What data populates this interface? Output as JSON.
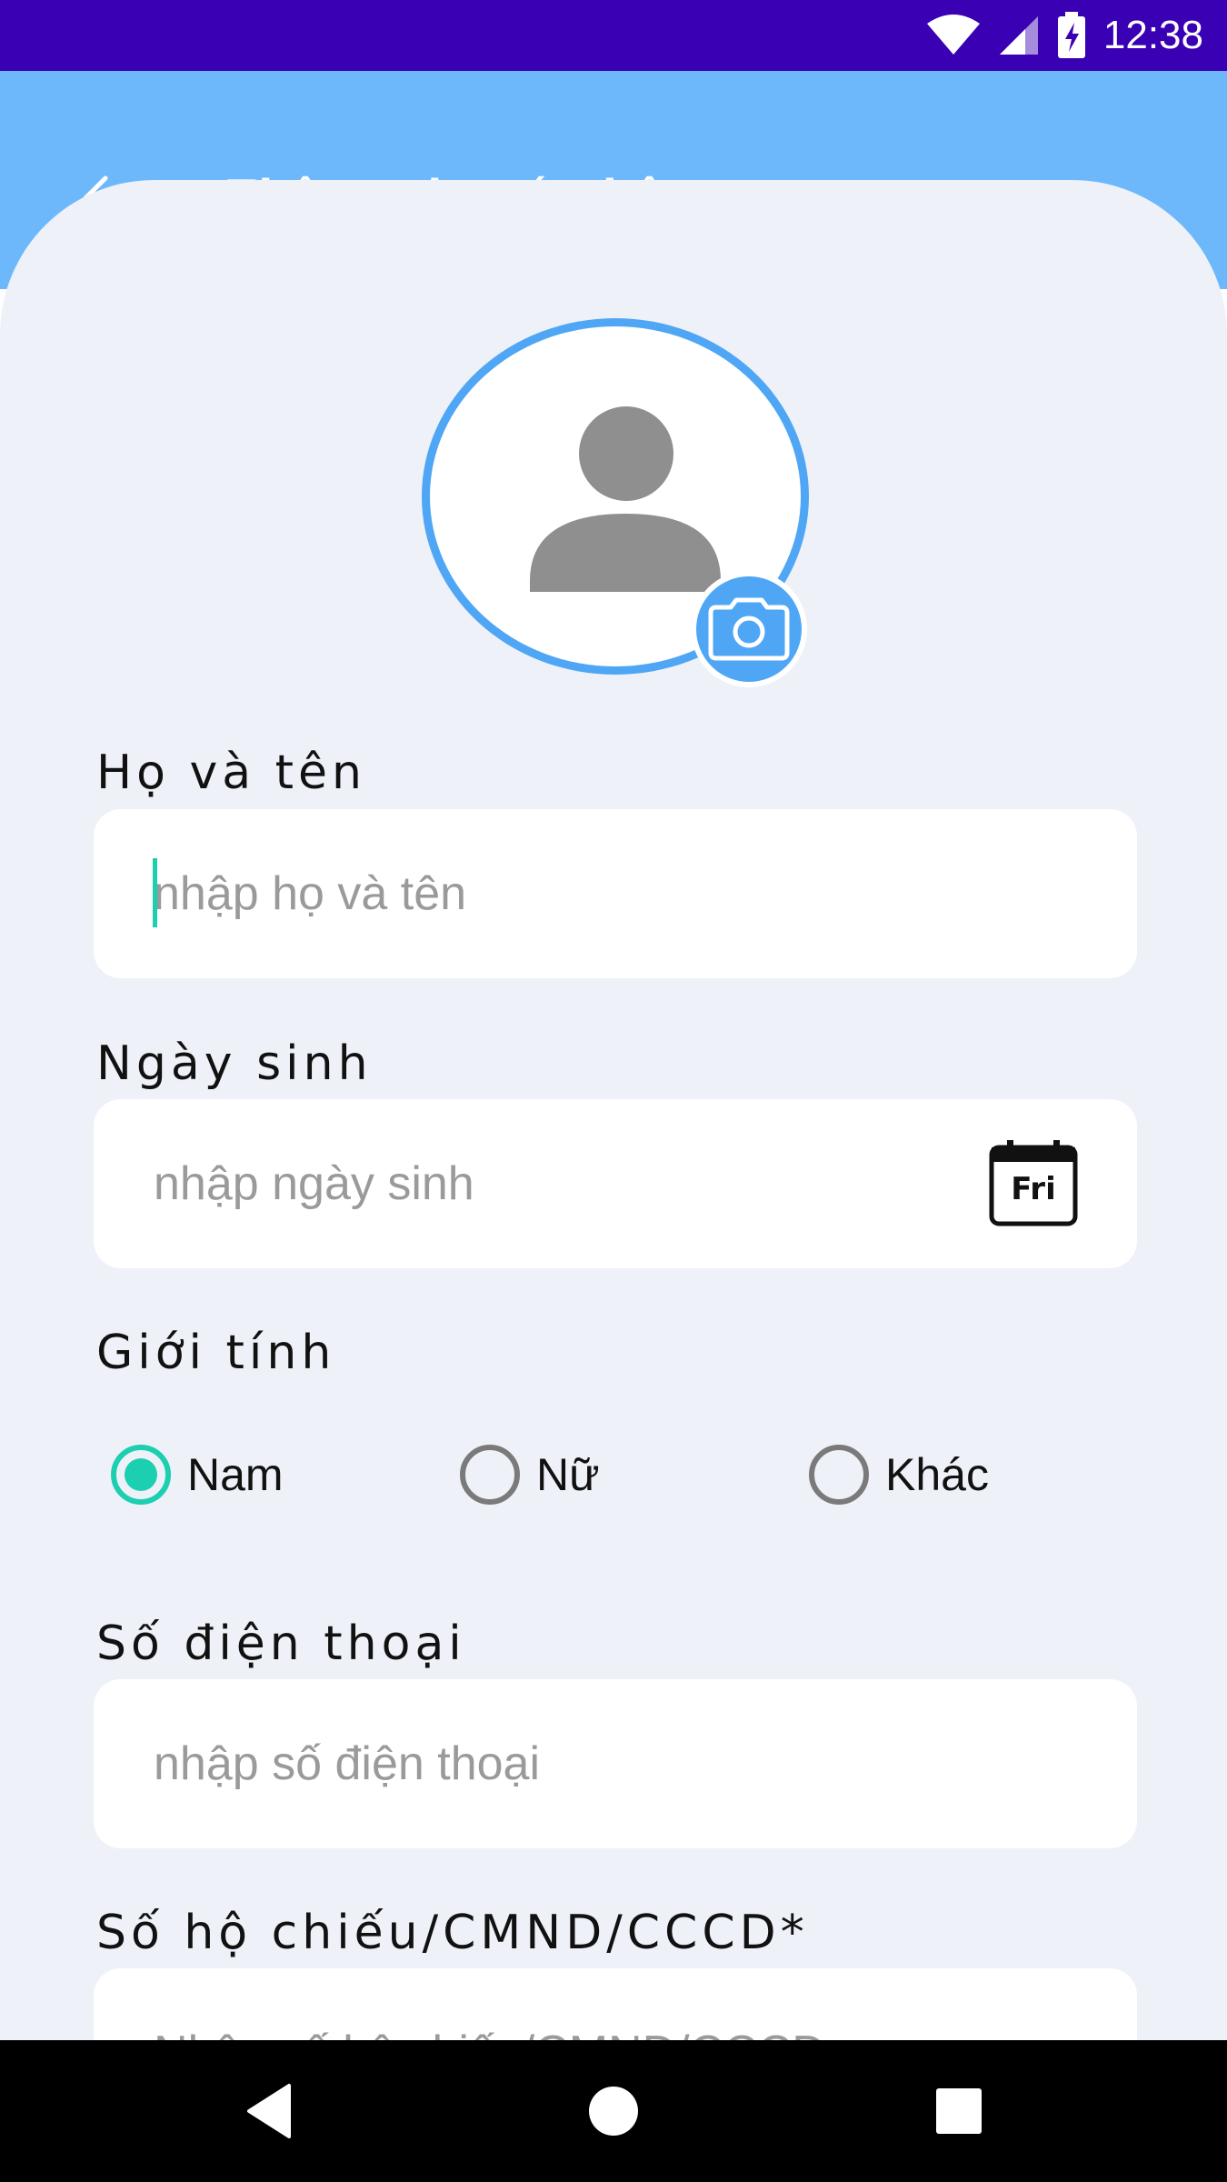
{
  "status_bar": {
    "time": "12:38",
    "icons": [
      "wifi-icon",
      "signal-icon",
      "battery-charging-icon"
    ]
  },
  "header": {
    "title": "Thông tin cá nhân",
    "back_icon": "arrow-left-icon"
  },
  "avatar": {
    "icon": "user-placeholder-icon",
    "camera_icon": "camera-icon"
  },
  "form": {
    "full_name": {
      "label": "Họ và tên",
      "placeholder": "nhập họ và tên",
      "value": ""
    },
    "birth_date": {
      "label": "Ngày sinh",
      "placeholder": "nhập ngày sinh",
      "value": "",
      "calendar_day": "Fri"
    },
    "gender": {
      "label": "Giới tính",
      "options": [
        "Nam",
        "Nữ",
        "Khác"
      ],
      "selected": "Nam"
    },
    "phone": {
      "label": "Số điện thoại",
      "placeholder": "nhập số điện thoại",
      "value": ""
    },
    "id_number": {
      "label": "Số hộ chiếu/CMND/CCCD*",
      "placeholder": "Nhập số hộ chiếu/CMND/CCCD",
      "value": ""
    }
  },
  "nav_bar": {
    "buttons": [
      "back-triangle-icon",
      "home-circle-icon",
      "recents-square-icon"
    ]
  },
  "colors": {
    "status_bar": "#3a00b3",
    "header": "#6db8fb",
    "background": "#eef1f8",
    "accent_blue": "#4fa6f5",
    "radio_accent": "#1ccfb0"
  }
}
